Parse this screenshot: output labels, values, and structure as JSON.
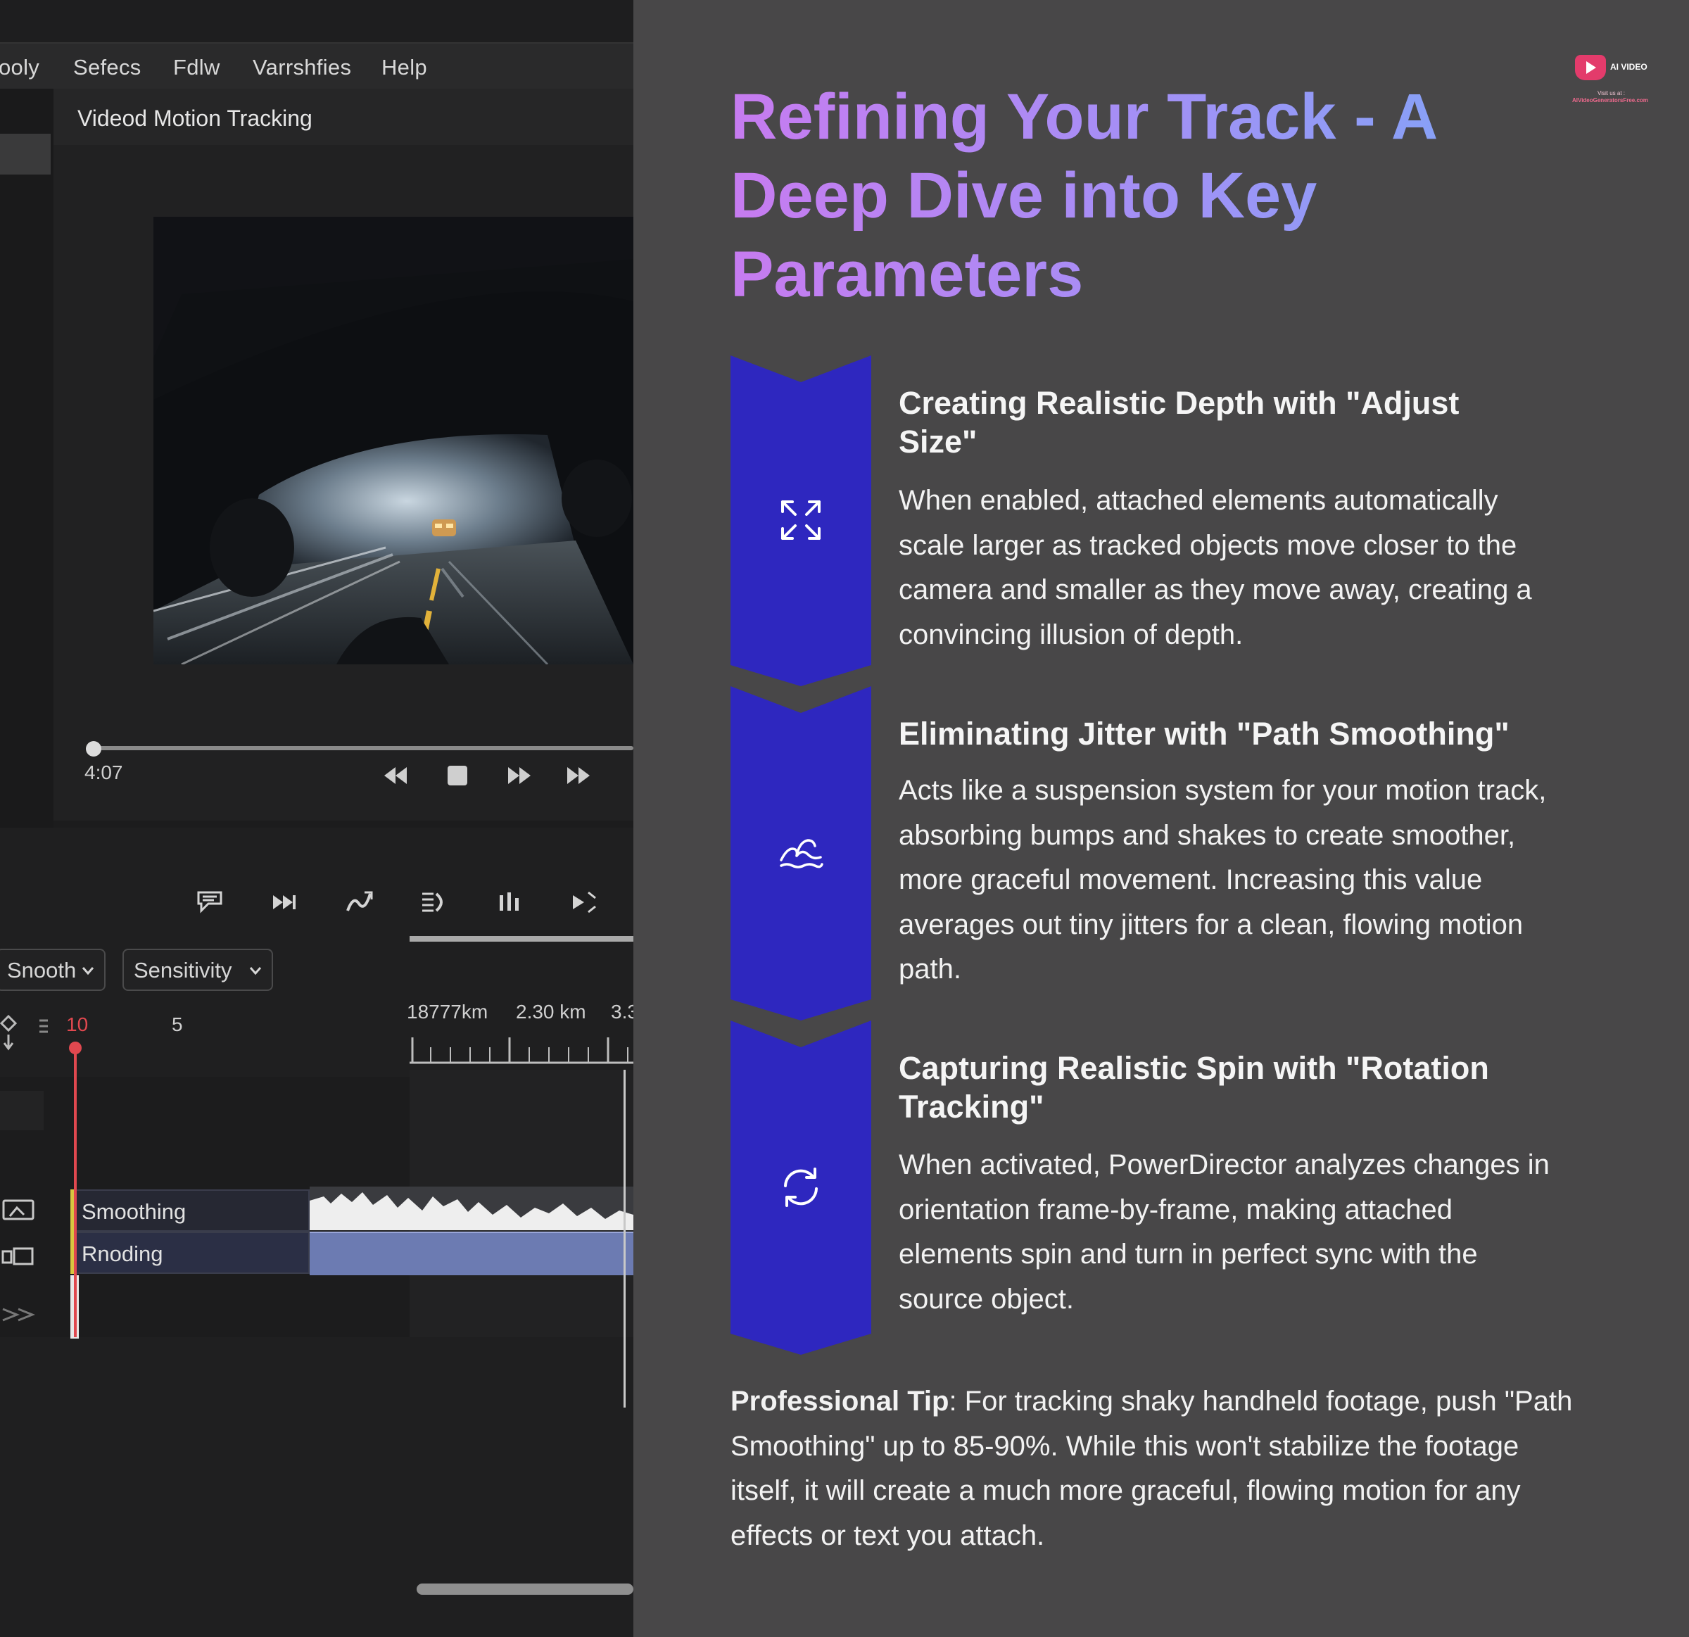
{
  "editor": {
    "menu": [
      "ooly",
      "Sefecs",
      "Fdlw",
      "Varrshfies",
      "Help"
    ],
    "panel_title": "Videod Motion Tracking",
    "timecode": "4:07",
    "dropdowns": {
      "smooth": "Snooth",
      "sensitivity": "Sensitivity"
    },
    "numbers": {
      "ten": "10",
      "five": "5"
    },
    "ruler_labels": [
      "18777km",
      "2.30 km",
      "3.3"
    ],
    "tracks": {
      "smoothing": "Smoothing",
      "rnoding": "Rnoding"
    },
    "playhead_color": "#e0484f",
    "clip_color": "#6c7bb2"
  },
  "article": {
    "headline": "Refining Your Track - A Deep Dive into Key Parameters",
    "logo": {
      "title": "AI VIDEO",
      "visit": "Visit us at :",
      "url": "AIVideoGeneratorsFree.com"
    },
    "accent_colors": {
      "heading_start": "#c77bf0",
      "heading_end": "#7fa6f7",
      "chevron": "#2e27bf"
    },
    "steps": [
      {
        "icon": "expand-arrows-icon",
        "title": "Creating Realistic Depth with \"Adjust Size\"",
        "body": "When enabled, attached elements automatically scale larger as tracked objects move closer to the camera and smaller as they move away, creating a convincing illusion of depth."
      },
      {
        "icon": "wave-icon",
        "title": "Eliminating Jitter with \"Path Smoothing\"",
        "body": "Acts like a suspension system for your motion track, absorbing bumps and shakes to create smoother, more graceful movement. Increasing this value averages out tiny jitters for a clean, flowing motion path."
      },
      {
        "icon": "rotate-arrows-icon",
        "title": "Capturing Realistic Spin with \"Rotation Tracking\"",
        "body": "When activated, PowerDirector analyzes changes in orientation frame-by-frame, making attached elements spin and turn in perfect sync with the source object."
      }
    ],
    "tip": {
      "label": "Professional Tip",
      "text": ": For tracking shaky handheld footage, push \"Path Smoothing\" up to 85-90%. While this won't stabilize the footage itself, it will create a much more graceful, flowing motion for any effects or text you attach."
    }
  }
}
